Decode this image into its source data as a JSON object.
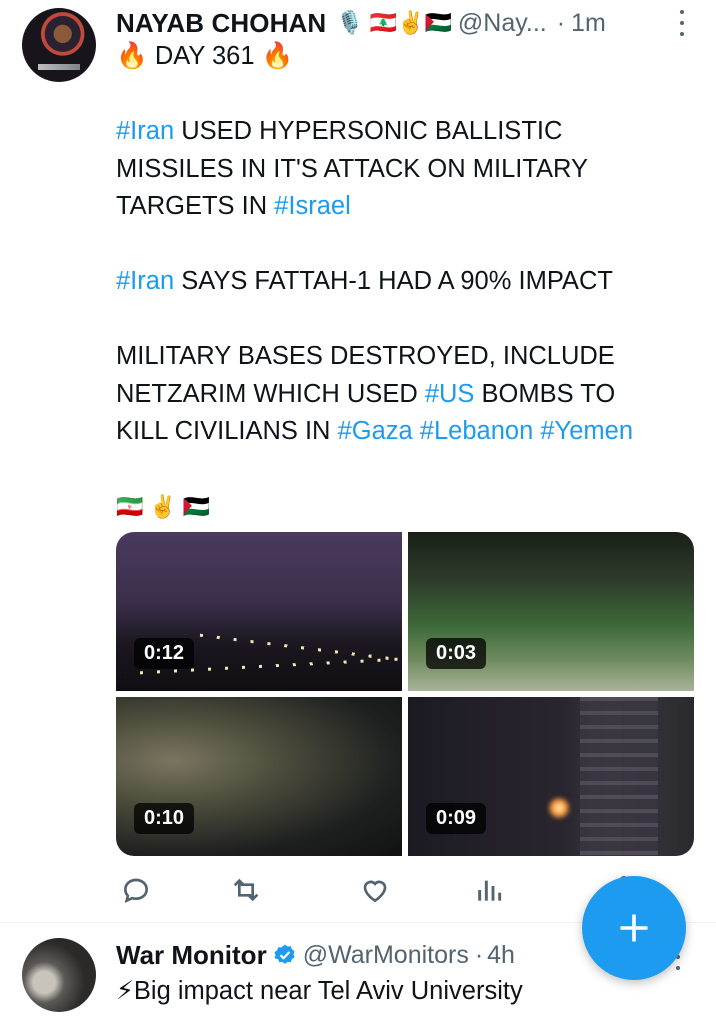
{
  "tweet1": {
    "author": {
      "name": "NAYAB CHOHAN",
      "name_emoji": "🎙️ 🇱🇧✌️🇵🇸",
      "handle": "@Nay...",
      "separator": "·",
      "time": "1m"
    },
    "text": {
      "line1": "🔥 DAY 361 🔥",
      "line2_tag": "#Iran",
      "line2_rest": " USED HYPERSONIC BALLISTIC",
      "line3": "MISSILES IN IT'S ATTACK ON MILITARY",
      "line4_pre": "TARGETS IN ",
      "line4_tag": "#Israel",
      "line5_tag": "#Iran",
      "line5_rest": " SAYS FATTAH-1 HAD A 90%  IMPACT",
      "line6": "MILITARY BASES DESTROYED, INCLUDE",
      "line7_pre": "NETZARIM WHICH USED ",
      "line7_tag": "#US",
      "line7_rest": " BOMBS TO",
      "line8_pre": "KILL CIVILIANS IN ",
      "line8_tag1": "#Gaza",
      "line8_tag2": "#Lebanon",
      "line8_tag3": "#Yemen",
      "flags": "🇮🇷✌️🇵🇸"
    },
    "media": [
      {
        "duration": "0:12"
      },
      {
        "duration": "0:03"
      },
      {
        "duration": "0:10"
      },
      {
        "duration": "0:09"
      }
    ],
    "actions": [
      "reply-icon",
      "retweet-icon",
      "like-icon",
      "views-icon",
      "share-icon"
    ]
  },
  "tweet2": {
    "author": {
      "name": "War Monitor",
      "handle": "@WarMonitors",
      "separator": "·",
      "time": "4h"
    },
    "text": "⚡Big impact near Tel Aviv University"
  },
  "fab": {
    "icon": "plus-icon"
  },
  "colors": {
    "accent": "#1d9bf0",
    "secondary_text": "#536471",
    "text": "#0f1419"
  }
}
